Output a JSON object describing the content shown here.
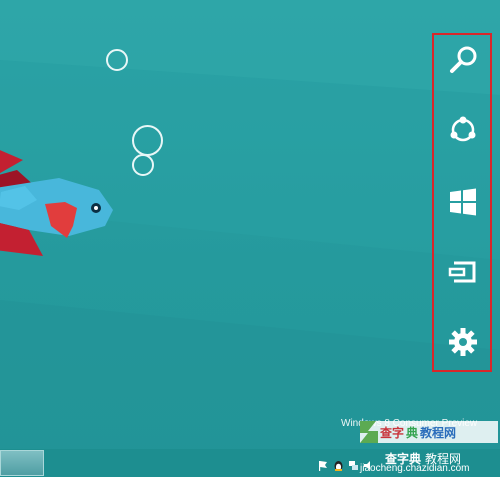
{
  "desktop": {
    "watermark": "Windows 8 Consumer Preview"
  },
  "charms": {
    "items": [
      {
        "name": "search",
        "icon": "search-icon"
      },
      {
        "name": "share",
        "icon": "share-icon"
      },
      {
        "name": "start",
        "icon": "windows-start-icon"
      },
      {
        "name": "devices",
        "icon": "devices-icon"
      },
      {
        "name": "settings",
        "icon": "gear-icon"
      }
    ],
    "highlight_color": "#d9262a"
  },
  "site": {
    "line1_a": "查字",
    "line1_b": "典",
    "line1_c": "教程网",
    "brand": "查字典",
    "brand_tail": "教程网",
    "url": "jiaocheng.chazidian.com"
  },
  "colors": {
    "background": "#2a9ea0",
    "fish_blue": "#48b7db",
    "fish_red": "#c32031",
    "bubble": "#e8f7f7"
  }
}
